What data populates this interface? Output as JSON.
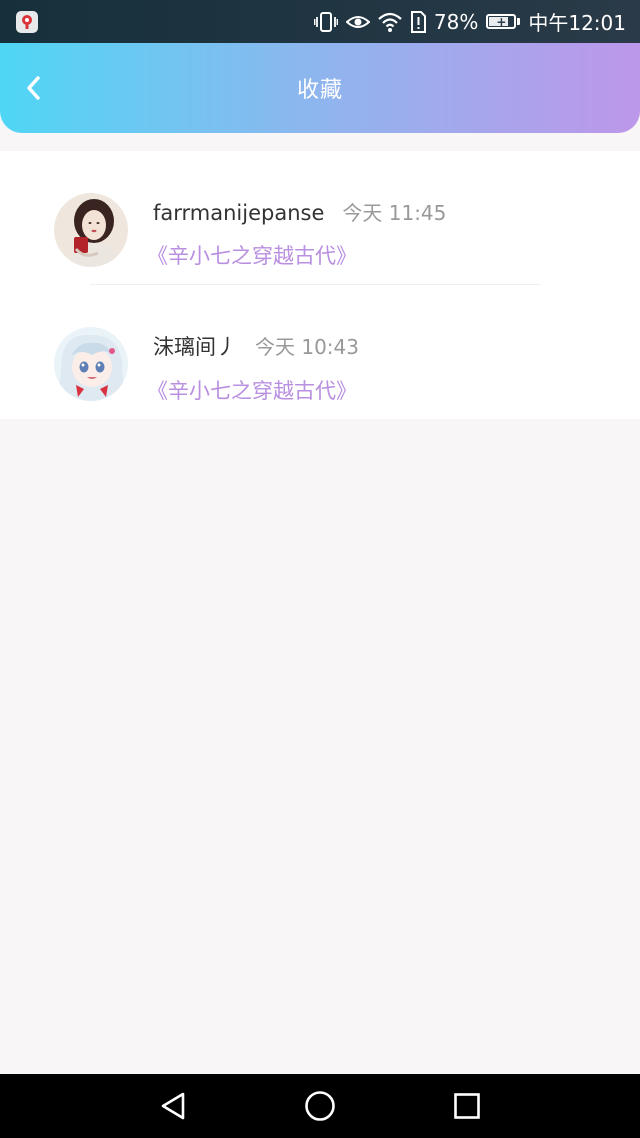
{
  "status_bar": {
    "battery_percent": "78%",
    "time": "中午12:01"
  },
  "header": {
    "title": "收藏",
    "gradient_start": "#4fd6f4",
    "gradient_end": "#bd97ea"
  },
  "favorites": [
    {
      "user_name": "farrmanijepanse",
      "time": "今天 11:45",
      "book_title": "《辛小七之穿越古代》"
    },
    {
      "user_name": "沫璃间丿",
      "time": "今天 10:43",
      "book_title": "《辛小七之穿越古代》"
    }
  ],
  "icons": {
    "back": "chevron-left-icon",
    "nav_back": "triangle-back-icon",
    "nav_home": "circle-home-icon",
    "nav_recents": "square-recents-icon"
  },
  "colors": {
    "accent_purple": "#b98fe0",
    "page_bg": "#f9f6f7"
  }
}
